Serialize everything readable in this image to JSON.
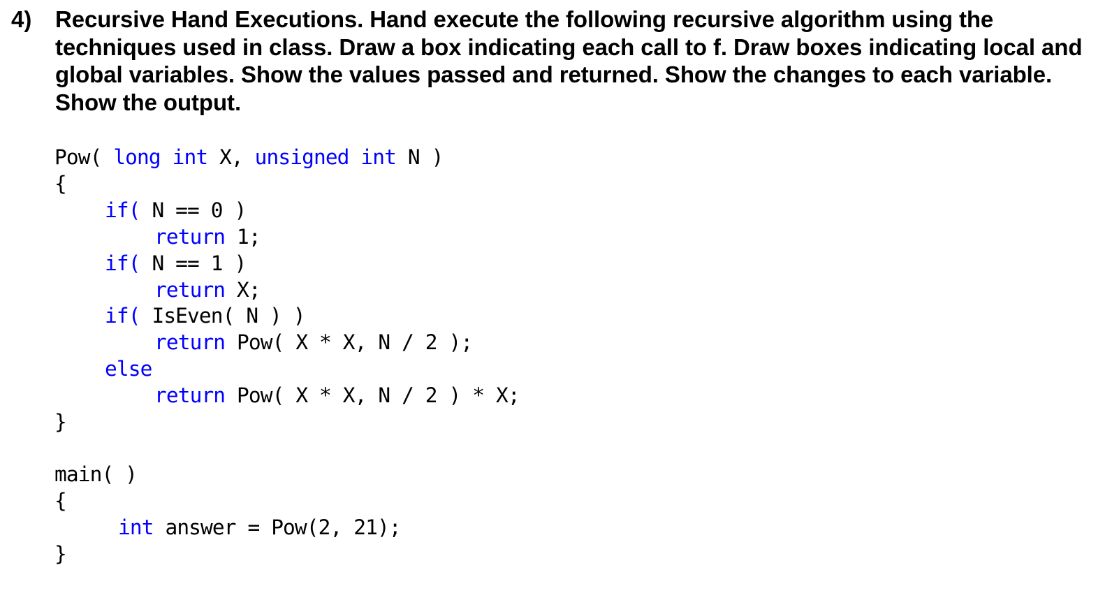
{
  "question": {
    "number": "4)",
    "text": "Recursive Hand Executions.  Hand execute the following recursive algorithm using the techniques used in class.  Draw a box indicating each call to f.  Draw boxes indicating local and global variables.  Show the values passed and returned.  Show the changes to each variable.  Show the output."
  },
  "code": {
    "pow_signature": {
      "name": "Pow( ",
      "kw1": "long int",
      "p1": " X, ",
      "kw2": "unsigned int",
      "p2": " N )"
    },
    "open_brace_1": "{",
    "if_n0": {
      "kw": "if(",
      "rest": " N == 0 )"
    },
    "return_1": {
      "kw": "return",
      "rest": " 1;"
    },
    "if_n1": {
      "kw": "if(",
      "rest": " N == 1 )"
    },
    "return_x": {
      "kw": "return",
      "rest": " X;"
    },
    "if_even": {
      "kw": "if(",
      "rest": " IsEven( N ) )"
    },
    "return_even": {
      "kw": "return",
      "rest": " Pow( X * X, N / 2 );"
    },
    "else": {
      "kw": "else"
    },
    "return_odd": {
      "kw": "return",
      "rest": " Pow( X * X, N / 2 ) * X;"
    },
    "close_brace_1": "}",
    "main_signature": "main( )",
    "open_brace_2": "{",
    "main_body": {
      "kw": "int",
      "rest": " answer = Pow(2, 21);"
    },
    "close_brace_2": "}"
  }
}
